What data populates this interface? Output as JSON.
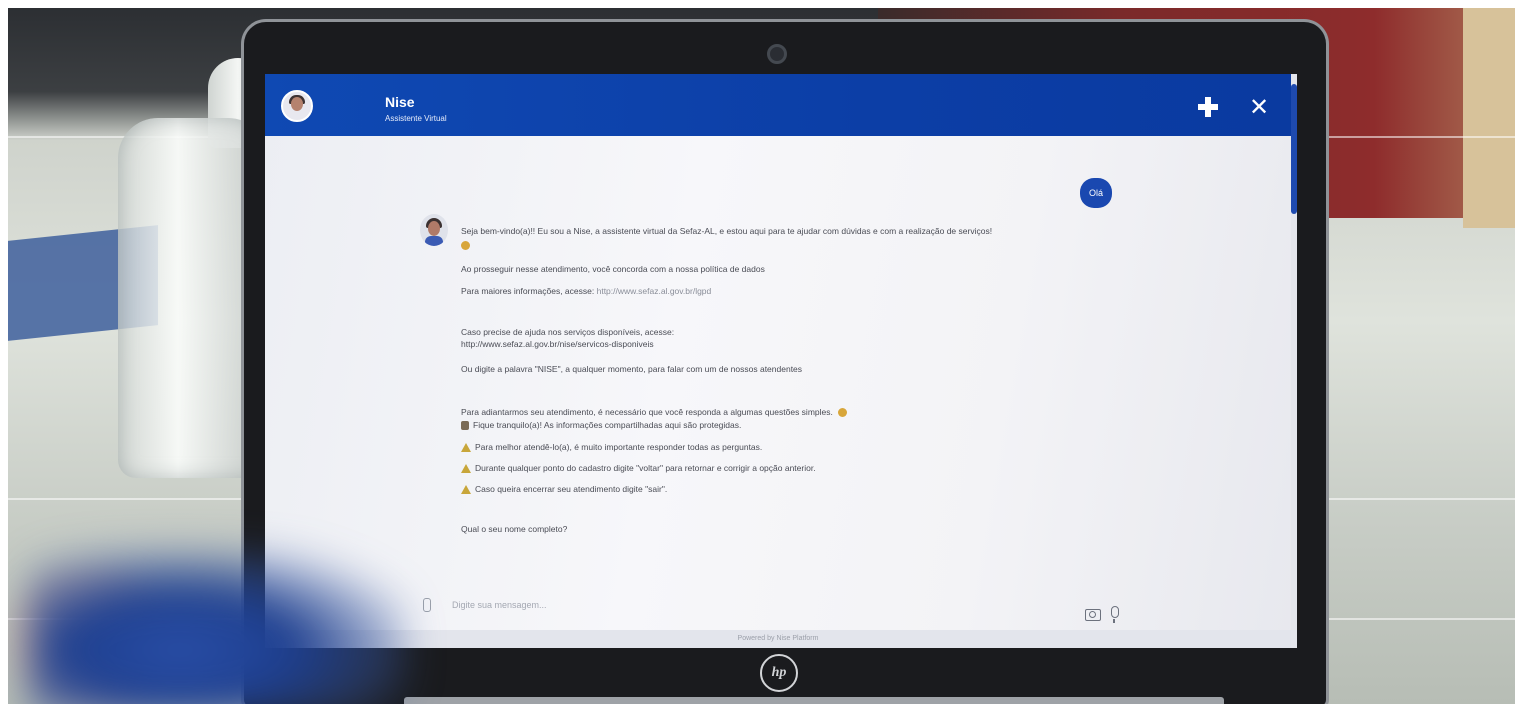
{
  "header": {
    "assistant_name": "Nise",
    "assistant_subtitle": "Assistente Virtual"
  },
  "chat": {
    "user_message": "Olá",
    "bot_messages": [
      "Seja bem-vindo(a)!! Eu sou a Nise, a assistente virtual da Sefaz-AL, e estou aqui para te ajudar com dúvidas e com a realização de serviços!",
      "Ao prosseguir nesse atendimento, você concorda com a nossa política de dados",
      "Para maiores informações, acesse:",
      "http://www.sefaz.al.gov.br/lgpd",
      "Caso precise de ajuda nos serviços disponíveis, acesse:",
      "http://www.sefaz.al.gov.br/nise/servicos-disponiveis",
      "Ou digite a palavra \"NISE\", a qualquer momento, para falar com um de nossos atendentes",
      "Para adiantarmos seu atendimento, é necessário que você responda a algumas questões simples.",
      "Fique tranquilo(a)! As informações compartilhadas aqui são protegidas.",
      "Para melhor atendê-lo(a), é muito importante responder todas as perguntas.",
      "Durante qualquer ponto do cadastro digite \"voltar\" para retornar e corrigir a opção anterior.",
      "Caso queira encerrar seu atendimento digite \"sair\".",
      "Qual o seu nome completo?"
    ]
  },
  "composer": {
    "placeholder": "Digite sua mensagem..."
  },
  "footer": {
    "powered_by": "Powered by Nise Platform"
  },
  "device": {
    "brand_logo": "hp"
  },
  "colors": {
    "header_blue": "#0c3ea6",
    "user_bubble": "#1a48b0"
  }
}
